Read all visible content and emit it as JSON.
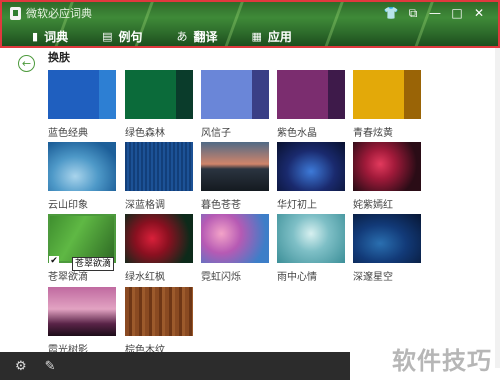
{
  "window": {
    "title": "微软必应词典",
    "minimize": "—",
    "maximize": "□",
    "close": "✕"
  },
  "nav": [
    {
      "label": "词典",
      "icon": "dictionary-icon",
      "glyph": "▮"
    },
    {
      "label": "例句",
      "icon": "sentence-icon",
      "glyph": "▤"
    },
    {
      "label": "翻译",
      "icon": "translate-icon",
      "glyph": "あ"
    },
    {
      "label": "应用",
      "icon": "apps-icon",
      "glyph": "▦"
    }
  ],
  "page": {
    "section_title": "换肤"
  },
  "skins": [
    {
      "name": "蓝色经典",
      "selected": false
    },
    {
      "name": "绿色森林",
      "selected": false
    },
    {
      "name": "风信子",
      "selected": false
    },
    {
      "name": "紫色水晶",
      "selected": false
    },
    {
      "name": "青春炫黄",
      "selected": false
    },
    {
      "name": "云山印象",
      "selected": false
    },
    {
      "name": "深蓝格调",
      "selected": false
    },
    {
      "name": "暮色苍苍",
      "selected": false
    },
    {
      "name": "华灯初上",
      "selected": false
    },
    {
      "name": "姹紫嫣红",
      "selected": false
    },
    {
      "name": "苍翠欲滴",
      "selected": true
    },
    {
      "name": "绿水红枫",
      "selected": false
    },
    {
      "name": "霓虹闪烁",
      "selected": false
    },
    {
      "name": "雨中心情",
      "selected": false
    },
    {
      "name": "深邃星空",
      "selected": false
    },
    {
      "name": "霞光树影",
      "selected": false
    },
    {
      "name": "棕色木纹",
      "selected": false
    }
  ],
  "tooltip": "苍翠欲滴",
  "footer": {
    "settings_icon": "gear-icon",
    "feedback_icon": "feedback-icon"
  },
  "watermark": "软件技巧",
  "colors": {
    "accent": "#4d9a3d",
    "header_border": "#e0383e",
    "footer": "#2c2c2c"
  }
}
